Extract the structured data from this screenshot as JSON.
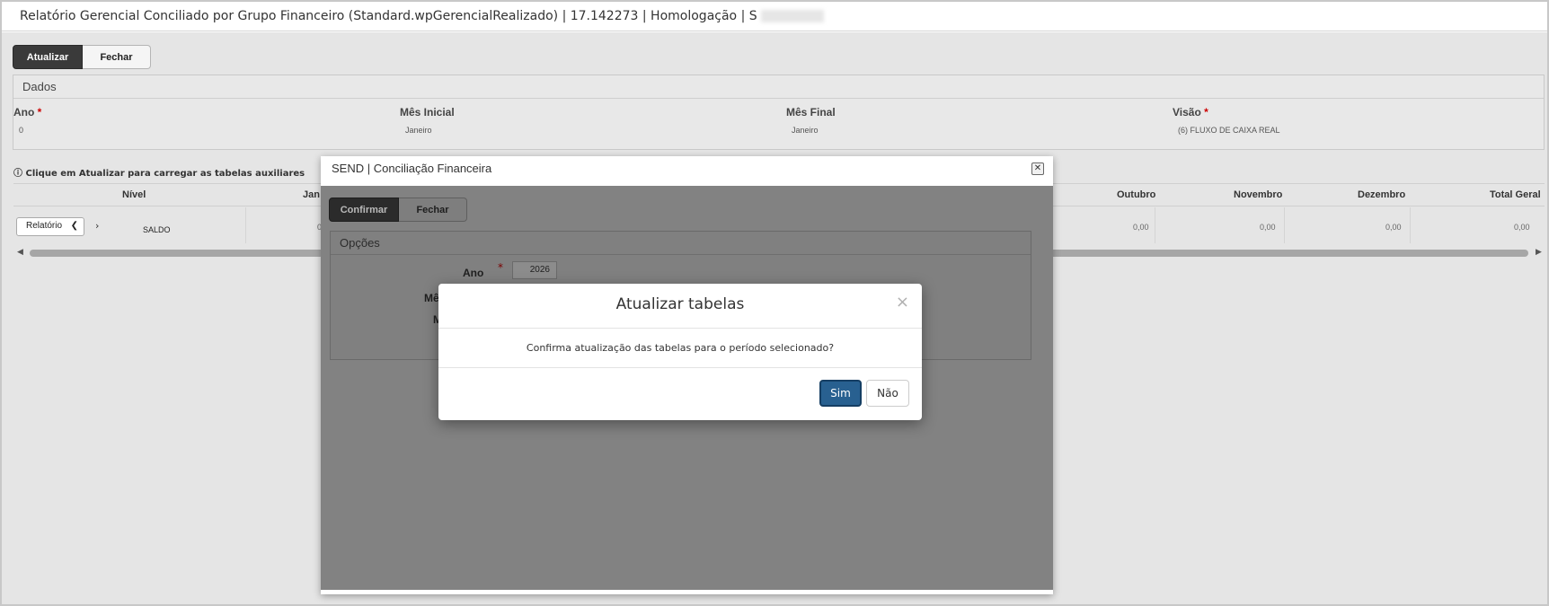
{
  "window": {
    "title": "Relatório Gerencial Conciliado por Grupo Financeiro (Standard.wpGerencialRealizado) | 17.142273 | Homologação | S"
  },
  "toolbar": {
    "update_label": "Atualizar",
    "close_label": "Fechar"
  },
  "dados": {
    "title": "Dados",
    "fields": [
      {
        "label": "Ano",
        "required": "*",
        "value": "0"
      },
      {
        "label": "Mês Inicial",
        "required": "",
        "value": "Janeiro"
      },
      {
        "label": "Mês Final",
        "required": "",
        "value": "Janeiro"
      },
      {
        "label": "Visão",
        "required": "*",
        "value": "(6) FLUXO DE CAIXA REAL"
      }
    ]
  },
  "info": {
    "icon": "info-circle-icon",
    "text": "Clique em Atualizar para carregar as tabelas auxiliares"
  },
  "grid": {
    "columns": [
      "Nível",
      "Jan",
      "Outubro",
      "Novembro",
      "Dezembro",
      "Total Geral"
    ],
    "row": {
      "select_value": "Relatório",
      "expand_icon": "chevron-right-icon",
      "label": "SALDO",
      "jan_partial": "0",
      "values": [
        "0,00",
        "0,00",
        "0,00",
        "0,00"
      ]
    }
  },
  "dialog": {
    "title": "SEND | Conciliação Financeira",
    "close_icon": "close-icon",
    "confirm_label": "Confirmar",
    "close_label": "Fechar",
    "options_title": "Opções",
    "ano_label": "Ano",
    "ano_required": "*",
    "ano_value": "2026",
    "label_partial_1": "Mê",
    "label_partial_2": "M"
  },
  "alert": {
    "title": "Atualizar tabelas",
    "message": "Confirma atualização das tabelas para o período selecionado?",
    "yes_label": "Sim",
    "no_label": "Não"
  },
  "colors": {
    "primary_button": "#286090",
    "dark_button": "#3a3a3a",
    "required": "#cc0000",
    "overlay": "#828282"
  }
}
